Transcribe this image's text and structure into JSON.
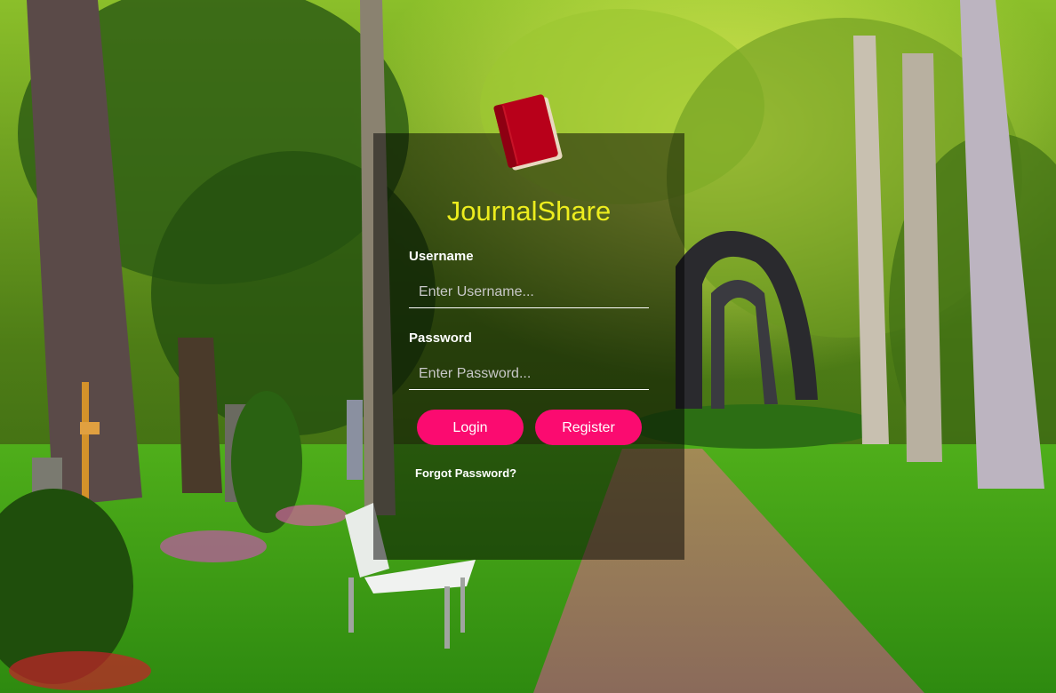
{
  "app": {
    "title": "JournalShare",
    "title_color": "#eded1e",
    "logo_icon": "book-icon"
  },
  "form": {
    "username_label": "Username",
    "username_placeholder": "Enter Username...",
    "username_value": "",
    "password_label": "Password",
    "password_placeholder": "Enter Password...",
    "password_value": "",
    "login_label": "Login",
    "register_label": "Register",
    "forgot_label": "Forgot Password?",
    "button_color": "#fb0b70"
  }
}
